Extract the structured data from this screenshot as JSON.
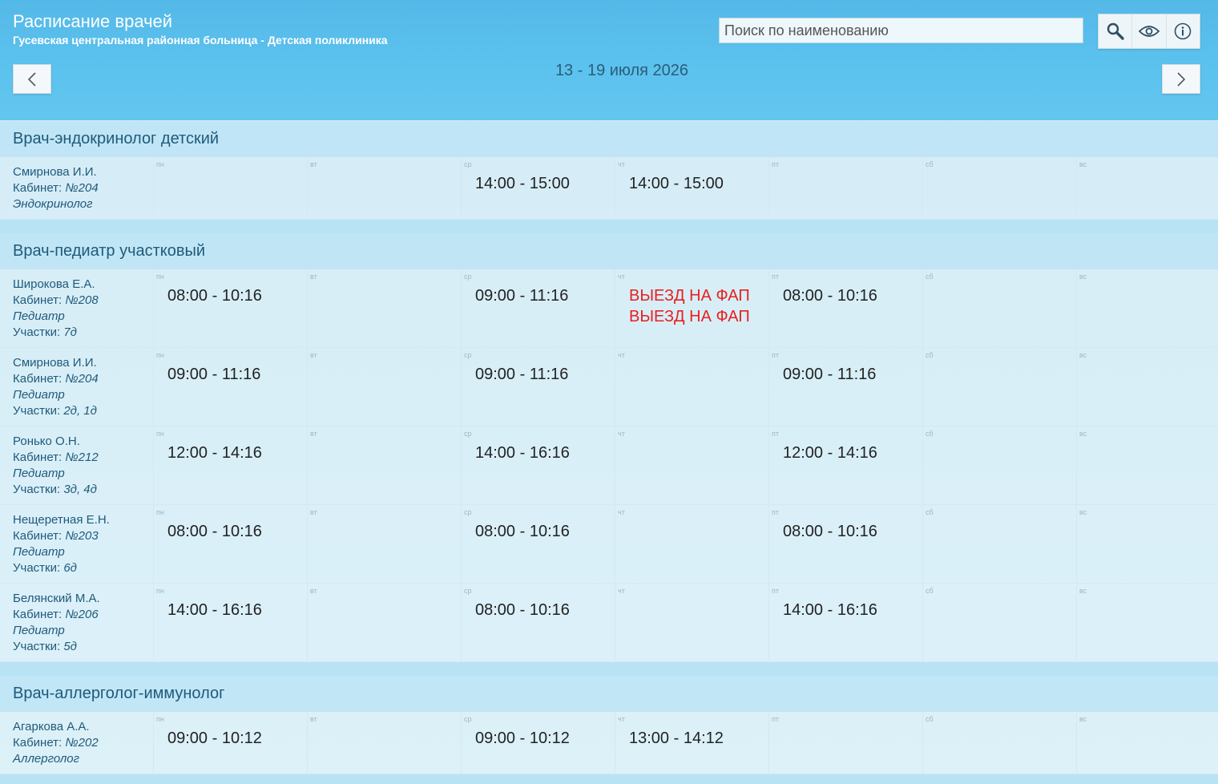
{
  "header": {
    "title": "Расписание врачей",
    "subtitle": "Гусевская центральная районная больница - Детская поликлиника",
    "search_placeholder": "Поиск по наименованию",
    "week_range": "13 - 19 июля 2026"
  },
  "day_labels": [
    "пн",
    "вт",
    "ср",
    "чт",
    "пт",
    "сб",
    "вс"
  ],
  "labels": {
    "cabinet": "Кабинет: ",
    "areas": "Участки: "
  },
  "sections": [
    {
      "title": "Врач-эндокринолог детский",
      "doctors": [
        {
          "name": "Смирнова И.И.",
          "cabinet": "№204",
          "specialty": "Эндокринолог",
          "areas": "",
          "slots": [
            "",
            "",
            "14:00 - 15:00",
            "14:00 - 15:00",
            "",
            "",
            ""
          ]
        }
      ]
    },
    {
      "title": "Врач-педиатр участковый",
      "doctors": [
        {
          "name": "Широкова Е.А.",
          "cabinet": "№208",
          "specialty": "Педиатр",
          "areas": "7д",
          "slots": [
            "08:00 - 10:16",
            "",
            "09:00 - 11:16",
            "ВЫЕЗД НА ФАП\nВЫЕЗД НА ФАП",
            "08:00 - 10:16",
            "",
            ""
          ]
        },
        {
          "name": "Смирнова И.И.",
          "cabinet": "№204",
          "specialty": "Педиатр",
          "areas": "2д, 1д",
          "slots": [
            "09:00 - 11:16",
            "",
            "09:00 - 11:16",
            "",
            "09:00 - 11:16",
            "",
            ""
          ]
        },
        {
          "name": "Ронько О.Н.",
          "cabinet": "№212",
          "specialty": "Педиатр",
          "areas": "3д, 4д",
          "slots": [
            "12:00 - 14:16",
            "",
            "14:00 - 16:16",
            "",
            "12:00 - 14:16",
            "",
            ""
          ]
        },
        {
          "name": "Нещеретная Е.Н.",
          "cabinet": "№203",
          "specialty": "Педиатр",
          "areas": "6д",
          "slots": [
            "08:00 - 10:16",
            "",
            "08:00 - 10:16",
            "",
            "08:00 - 10:16",
            "",
            ""
          ]
        },
        {
          "name": "Белянский М.А.",
          "cabinet": "№206",
          "specialty": "Педиатр",
          "areas": "5д",
          "slots": [
            "14:00 - 16:16",
            "",
            "08:00 - 10:16",
            "",
            "14:00 - 16:16",
            "",
            ""
          ]
        }
      ]
    },
    {
      "title": "Врач-аллерголог-иммунолог",
      "doctors": [
        {
          "name": "Агаркова А.А.",
          "cabinet": "№202",
          "specialty": "Аллерголог",
          "areas": "",
          "slots": [
            "09:00 - 10:12",
            "",
            "09:00 - 10:12",
            "13:00 - 14:12",
            "",
            "",
            ""
          ]
        }
      ]
    }
  ],
  "colors": {
    "header_bg": "#5cc2ee",
    "alert": "#e82020",
    "text_dark": "#1f5a7a"
  }
}
